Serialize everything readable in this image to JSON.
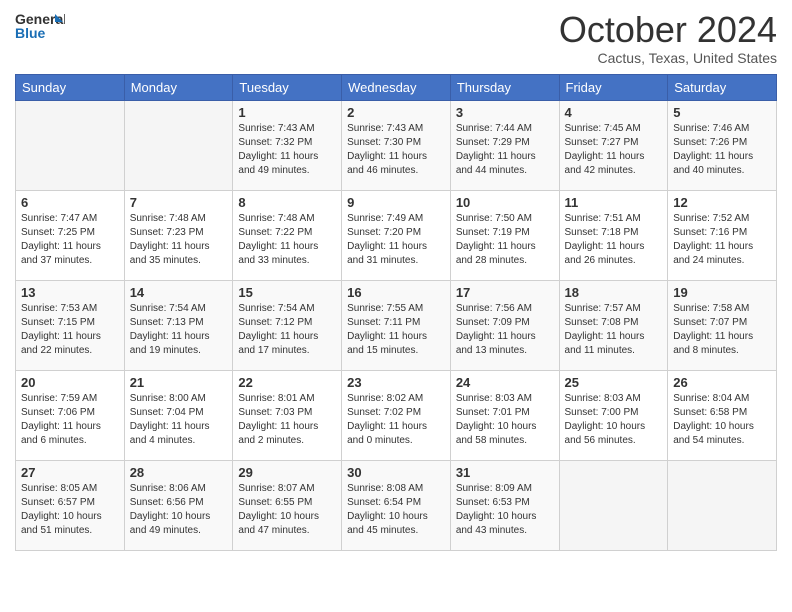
{
  "header": {
    "logo_line1": "General",
    "logo_line2": "Blue",
    "month_title": "October 2024",
    "location": "Cactus, Texas, United States"
  },
  "days_of_week": [
    "Sunday",
    "Monday",
    "Tuesday",
    "Wednesday",
    "Thursday",
    "Friday",
    "Saturday"
  ],
  "weeks": [
    [
      {
        "day": "",
        "empty": true
      },
      {
        "day": "",
        "empty": true
      },
      {
        "day": "1",
        "sunrise": "Sunrise: 7:43 AM",
        "sunset": "Sunset: 7:32 PM",
        "daylight": "Daylight: 11 hours and 49 minutes."
      },
      {
        "day": "2",
        "sunrise": "Sunrise: 7:43 AM",
        "sunset": "Sunset: 7:30 PM",
        "daylight": "Daylight: 11 hours and 46 minutes."
      },
      {
        "day": "3",
        "sunrise": "Sunrise: 7:44 AM",
        "sunset": "Sunset: 7:29 PM",
        "daylight": "Daylight: 11 hours and 44 minutes."
      },
      {
        "day": "4",
        "sunrise": "Sunrise: 7:45 AM",
        "sunset": "Sunset: 7:27 PM",
        "daylight": "Daylight: 11 hours and 42 minutes."
      },
      {
        "day": "5",
        "sunrise": "Sunrise: 7:46 AM",
        "sunset": "Sunset: 7:26 PM",
        "daylight": "Daylight: 11 hours and 40 minutes."
      }
    ],
    [
      {
        "day": "6",
        "sunrise": "Sunrise: 7:47 AM",
        "sunset": "Sunset: 7:25 PM",
        "daylight": "Daylight: 11 hours and 37 minutes."
      },
      {
        "day": "7",
        "sunrise": "Sunrise: 7:48 AM",
        "sunset": "Sunset: 7:23 PM",
        "daylight": "Daylight: 11 hours and 35 minutes."
      },
      {
        "day": "8",
        "sunrise": "Sunrise: 7:48 AM",
        "sunset": "Sunset: 7:22 PM",
        "daylight": "Daylight: 11 hours and 33 minutes."
      },
      {
        "day": "9",
        "sunrise": "Sunrise: 7:49 AM",
        "sunset": "Sunset: 7:20 PM",
        "daylight": "Daylight: 11 hours and 31 minutes."
      },
      {
        "day": "10",
        "sunrise": "Sunrise: 7:50 AM",
        "sunset": "Sunset: 7:19 PM",
        "daylight": "Daylight: 11 hours and 28 minutes."
      },
      {
        "day": "11",
        "sunrise": "Sunrise: 7:51 AM",
        "sunset": "Sunset: 7:18 PM",
        "daylight": "Daylight: 11 hours and 26 minutes."
      },
      {
        "day": "12",
        "sunrise": "Sunrise: 7:52 AM",
        "sunset": "Sunset: 7:16 PM",
        "daylight": "Daylight: 11 hours and 24 minutes."
      }
    ],
    [
      {
        "day": "13",
        "sunrise": "Sunrise: 7:53 AM",
        "sunset": "Sunset: 7:15 PM",
        "daylight": "Daylight: 11 hours and 22 minutes."
      },
      {
        "day": "14",
        "sunrise": "Sunrise: 7:54 AM",
        "sunset": "Sunset: 7:13 PM",
        "daylight": "Daylight: 11 hours and 19 minutes."
      },
      {
        "day": "15",
        "sunrise": "Sunrise: 7:54 AM",
        "sunset": "Sunset: 7:12 PM",
        "daylight": "Daylight: 11 hours and 17 minutes."
      },
      {
        "day": "16",
        "sunrise": "Sunrise: 7:55 AM",
        "sunset": "Sunset: 7:11 PM",
        "daylight": "Daylight: 11 hours and 15 minutes."
      },
      {
        "day": "17",
        "sunrise": "Sunrise: 7:56 AM",
        "sunset": "Sunset: 7:09 PM",
        "daylight": "Daylight: 11 hours and 13 minutes."
      },
      {
        "day": "18",
        "sunrise": "Sunrise: 7:57 AM",
        "sunset": "Sunset: 7:08 PM",
        "daylight": "Daylight: 11 hours and 11 minutes."
      },
      {
        "day": "19",
        "sunrise": "Sunrise: 7:58 AM",
        "sunset": "Sunset: 7:07 PM",
        "daylight": "Daylight: 11 hours and 8 minutes."
      }
    ],
    [
      {
        "day": "20",
        "sunrise": "Sunrise: 7:59 AM",
        "sunset": "Sunset: 7:06 PM",
        "daylight": "Daylight: 11 hours and 6 minutes."
      },
      {
        "day": "21",
        "sunrise": "Sunrise: 8:00 AM",
        "sunset": "Sunset: 7:04 PM",
        "daylight": "Daylight: 11 hours and 4 minutes."
      },
      {
        "day": "22",
        "sunrise": "Sunrise: 8:01 AM",
        "sunset": "Sunset: 7:03 PM",
        "daylight": "Daylight: 11 hours and 2 minutes."
      },
      {
        "day": "23",
        "sunrise": "Sunrise: 8:02 AM",
        "sunset": "Sunset: 7:02 PM",
        "daylight": "Daylight: 11 hours and 0 minutes."
      },
      {
        "day": "24",
        "sunrise": "Sunrise: 8:03 AM",
        "sunset": "Sunset: 7:01 PM",
        "daylight": "Daylight: 10 hours and 58 minutes."
      },
      {
        "day": "25",
        "sunrise": "Sunrise: 8:03 AM",
        "sunset": "Sunset: 7:00 PM",
        "daylight": "Daylight: 10 hours and 56 minutes."
      },
      {
        "day": "26",
        "sunrise": "Sunrise: 8:04 AM",
        "sunset": "Sunset: 6:58 PM",
        "daylight": "Daylight: 10 hours and 54 minutes."
      }
    ],
    [
      {
        "day": "27",
        "sunrise": "Sunrise: 8:05 AM",
        "sunset": "Sunset: 6:57 PM",
        "daylight": "Daylight: 10 hours and 51 minutes."
      },
      {
        "day": "28",
        "sunrise": "Sunrise: 8:06 AM",
        "sunset": "Sunset: 6:56 PM",
        "daylight": "Daylight: 10 hours and 49 minutes."
      },
      {
        "day": "29",
        "sunrise": "Sunrise: 8:07 AM",
        "sunset": "Sunset: 6:55 PM",
        "daylight": "Daylight: 10 hours and 47 minutes."
      },
      {
        "day": "30",
        "sunrise": "Sunrise: 8:08 AM",
        "sunset": "Sunset: 6:54 PM",
        "daylight": "Daylight: 10 hours and 45 minutes."
      },
      {
        "day": "31",
        "sunrise": "Sunrise: 8:09 AM",
        "sunset": "Sunset: 6:53 PM",
        "daylight": "Daylight: 10 hours and 43 minutes."
      },
      {
        "day": "",
        "empty": true
      },
      {
        "day": "",
        "empty": true
      }
    ]
  ]
}
